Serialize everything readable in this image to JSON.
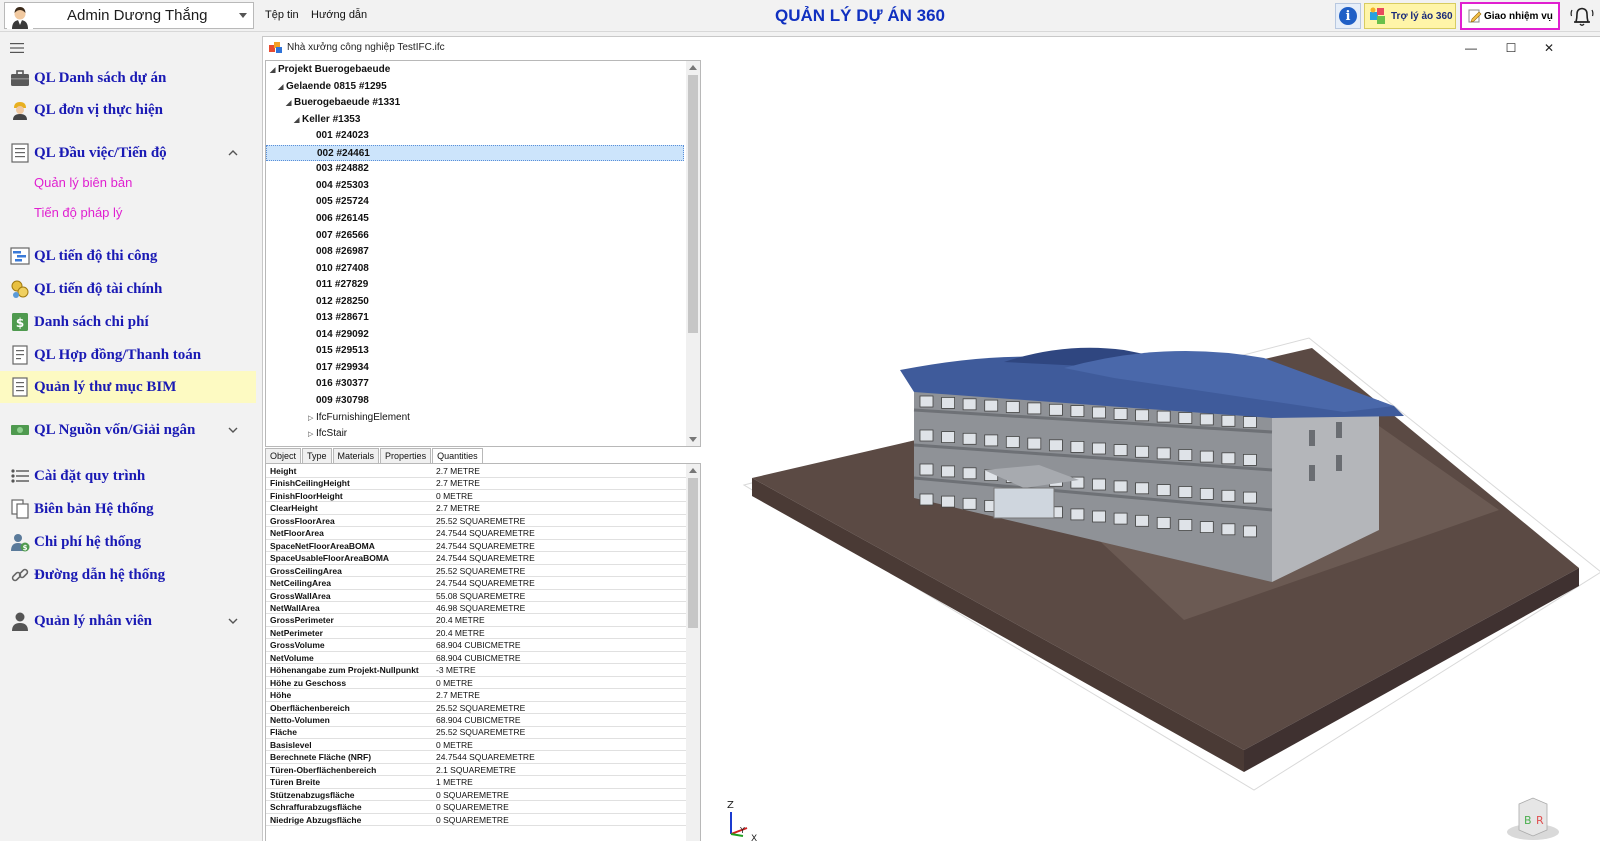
{
  "app": {
    "title": "QUẢN LÝ DỰ ÁN 360",
    "user_name": "Admin Dương Thắng",
    "menu": [
      "Tệp tin",
      "Hướng dẫn"
    ],
    "assistant_label": "Trợ lý ảo 360",
    "task_label": "Giao nhiệm vụ",
    "info_glyph": "i",
    "accent_color": "#1a1ab4",
    "sub_color": "#e020d0",
    "highlight_color": "#e020d0"
  },
  "sidebar": {
    "items": [
      {
        "label": "QL Danh sách dự án",
        "icon": "briefcase-icon"
      },
      {
        "label": "QL đơn vị thực hiện",
        "icon": "worker-icon"
      },
      {
        "label": "QL Đầu việc/Tiến độ",
        "icon": "checklist-icon",
        "expanded": true
      },
      {
        "label": "QL tiến độ thi công",
        "icon": "gantt-icon"
      },
      {
        "label": "QL tiến độ tài chính",
        "icon": "coins-icon"
      },
      {
        "label": "Danh sách chi phí",
        "icon": "money-icon"
      },
      {
        "label": "QL Hợp đồng/Thanh toán",
        "icon": "contract-icon"
      },
      {
        "label": "Quản lý thư mục BIM",
        "icon": "document-icon",
        "active": true
      },
      {
        "label": "QL Nguồn vốn/Giải ngân",
        "icon": "cash-icon",
        "collapsible": true
      },
      {
        "label": "Cài đặt quy trình",
        "icon": "list-icon"
      },
      {
        "label": "Biên bản Hệ thống",
        "icon": "copy-icon"
      },
      {
        "label": "Chi phí hệ thống",
        "icon": "dollar-person-icon"
      },
      {
        "label": "Đường dẫn hệ thống",
        "icon": "link-icon"
      },
      {
        "label": "Quản lý nhân viên",
        "icon": "person-icon",
        "collapsible": true
      }
    ],
    "subitems": [
      "Quản lý biên bản",
      "Tiến độ pháp lý"
    ]
  },
  "document": {
    "title": "Nhà xưởng công nghiệp TestIFC.ifc",
    "window_controls": [
      "—",
      "☐",
      "✕"
    ]
  },
  "tree": {
    "nodes": [
      {
        "label": "Projekt Buerogebaeude",
        "depth": 0,
        "expanded": true
      },
      {
        "label": "Gelaende 0815 #1295",
        "depth": 1,
        "expanded": true
      },
      {
        "label": "Buerogebaeude #1331",
        "depth": 2,
        "expanded": true
      },
      {
        "label": "Keller #1353",
        "depth": 3,
        "expanded": true
      },
      {
        "label": "001 #24023",
        "depth": 4
      },
      {
        "label": "002 #24461",
        "depth": 4,
        "selected": true
      },
      {
        "label": "003 #24882",
        "depth": 4
      },
      {
        "label": "004 #25303",
        "depth": 4
      },
      {
        "label": "005 #25724",
        "depth": 4
      },
      {
        "label": "006 #26145",
        "depth": 4
      },
      {
        "label": "007 #26566",
        "depth": 4
      },
      {
        "label": "008 #26987",
        "depth": 4
      },
      {
        "label": "010 #27408",
        "depth": 4
      },
      {
        "label": "011 #27829",
        "depth": 4
      },
      {
        "label": "012 #28250",
        "depth": 4
      },
      {
        "label": "013 #28671",
        "depth": 4
      },
      {
        "label": "014 #29092",
        "depth": 4
      },
      {
        "label": "015 #29513",
        "depth": 4
      },
      {
        "label": "017 #29934",
        "depth": 4
      },
      {
        "label": "016 #30377",
        "depth": 4
      },
      {
        "label": "009 #30798",
        "depth": 4
      },
      {
        "label": "IfcFurnishingElement",
        "depth": 4,
        "collapsed": true,
        "light": true
      },
      {
        "label": "IfcStair",
        "depth": 4,
        "collapsed": true,
        "light": true
      }
    ]
  },
  "tabs": [
    "Object",
    "Type",
    "Materials",
    "Properties",
    "Quantities"
  ],
  "active_tab": "Quantities",
  "quantities": [
    {
      "name": "Height",
      "value": "2.7 METRE"
    },
    {
      "name": "FinishCeilingHeight",
      "value": "2.7 METRE"
    },
    {
      "name": "FinishFloorHeight",
      "value": "0 METRE"
    },
    {
      "name": "ClearHeight",
      "value": "2.7 METRE"
    },
    {
      "name": "GrossFloorArea",
      "value": "25.52 SQUAREMETRE"
    },
    {
      "name": "NetFloorArea",
      "value": "24.7544 SQUAREMETRE"
    },
    {
      "name": "SpaceNetFloorAreaBOMA",
      "value": "24.7544 SQUAREMETRE"
    },
    {
      "name": "SpaceUsableFloorAreaBOMA",
      "value": "24.7544 SQUAREMETRE"
    },
    {
      "name": "GrossCeilingArea",
      "value": "25.52 SQUAREMETRE"
    },
    {
      "name": "NetCeilingArea",
      "value": "24.7544 SQUAREMETRE"
    },
    {
      "name": "GrossWallArea",
      "value": "55.08 SQUAREMETRE"
    },
    {
      "name": "NetWallArea",
      "value": "46.98 SQUAREMETRE"
    },
    {
      "name": "GrossPerimeter",
      "value": "20.4 METRE"
    },
    {
      "name": "NetPerimeter",
      "value": "20.4 METRE"
    },
    {
      "name": "GrossVolume",
      "value": "68.904 CUBICMETRE"
    },
    {
      "name": "NetVolume",
      "value": "68.904 CUBICMETRE"
    },
    {
      "name": "Höhenangabe zum Projekt-Nullpunkt",
      "value": "-3 METRE"
    },
    {
      "name": "Höhe zu Geschoss",
      "value": "0 METRE"
    },
    {
      "name": "Höhe",
      "value": "2.7 METRE"
    },
    {
      "name": "Oberflächenbereich",
      "value": "25.52 SQUAREMETRE"
    },
    {
      "name": "Netto-Volumen",
      "value": "68.904 CUBICMETRE"
    },
    {
      "name": "Fläche",
      "value": "25.52 SQUAREMETRE"
    },
    {
      "name": "Basislevel",
      "value": "0 METRE"
    },
    {
      "name": "Berechnete Fläche (NRF)",
      "value": "24.7544 SQUAREMETRE"
    },
    {
      "name": "Türen-Oberflächenbereich",
      "value": "2.1 SQUAREMETRE"
    },
    {
      "name": "Türen Breite",
      "value": "1 METRE"
    },
    {
      "name": "Stützenabzugsfläche",
      "value": "0 SQUAREMETRE"
    },
    {
      "name": "Schraffurabzugsfläche",
      "value": "0 SQUAREMETRE"
    },
    {
      "name": "Niedrige Abzugsfläche",
      "value": "0 SQUAREMETRE"
    }
  ],
  "viewport": {
    "axis_labels": [
      "Z",
      "Y",
      "X"
    ],
    "cube_labels": [
      "B",
      "R"
    ],
    "ground_color": "#5b4a44",
    "roof_color": "#3f5b9b",
    "wall_color": "#9b9ea4"
  }
}
